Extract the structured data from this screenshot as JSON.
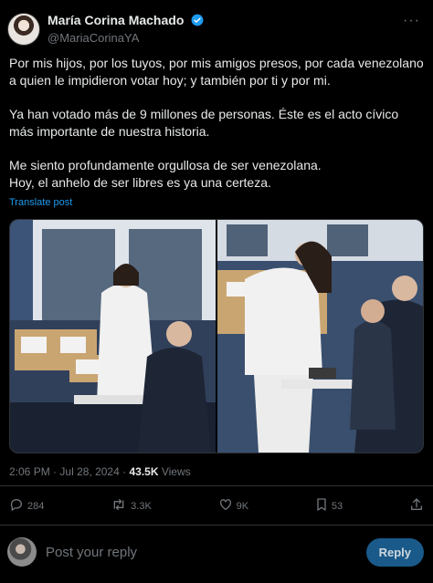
{
  "author": {
    "display_name": "María Corina Machado",
    "handle": "@MariaCorinaYA"
  },
  "tweet": {
    "paragraphs": [
      "Por mis hijos, por los tuyos, por mis amigos presos, por cada venezolano a quien le impidieron votar hoy; y también por ti y por mi.",
      "Ya han votado más de 9 millones de personas. Éste es el acto cívico más importante de nuestra historia.",
      "Me siento profundamente orgullosa de ser venezolana.\nHoy, el anhelo de ser libres es ya una certeza."
    ],
    "translate_label": "Translate post"
  },
  "meta": {
    "time": "2:06 PM",
    "date": "Jul 28, 2024",
    "views_count": "43.5K",
    "views_label": "Views"
  },
  "actions": {
    "replies": "284",
    "reposts": "3.3K",
    "likes": "9K",
    "bookmarks": "53"
  },
  "reply_box": {
    "placeholder": "Post your reply",
    "button_label": "Reply"
  },
  "colors": {
    "background": "#000000",
    "text": "#e7e9ea",
    "secondary": "#71767b",
    "accent": "#1d9bf0"
  }
}
